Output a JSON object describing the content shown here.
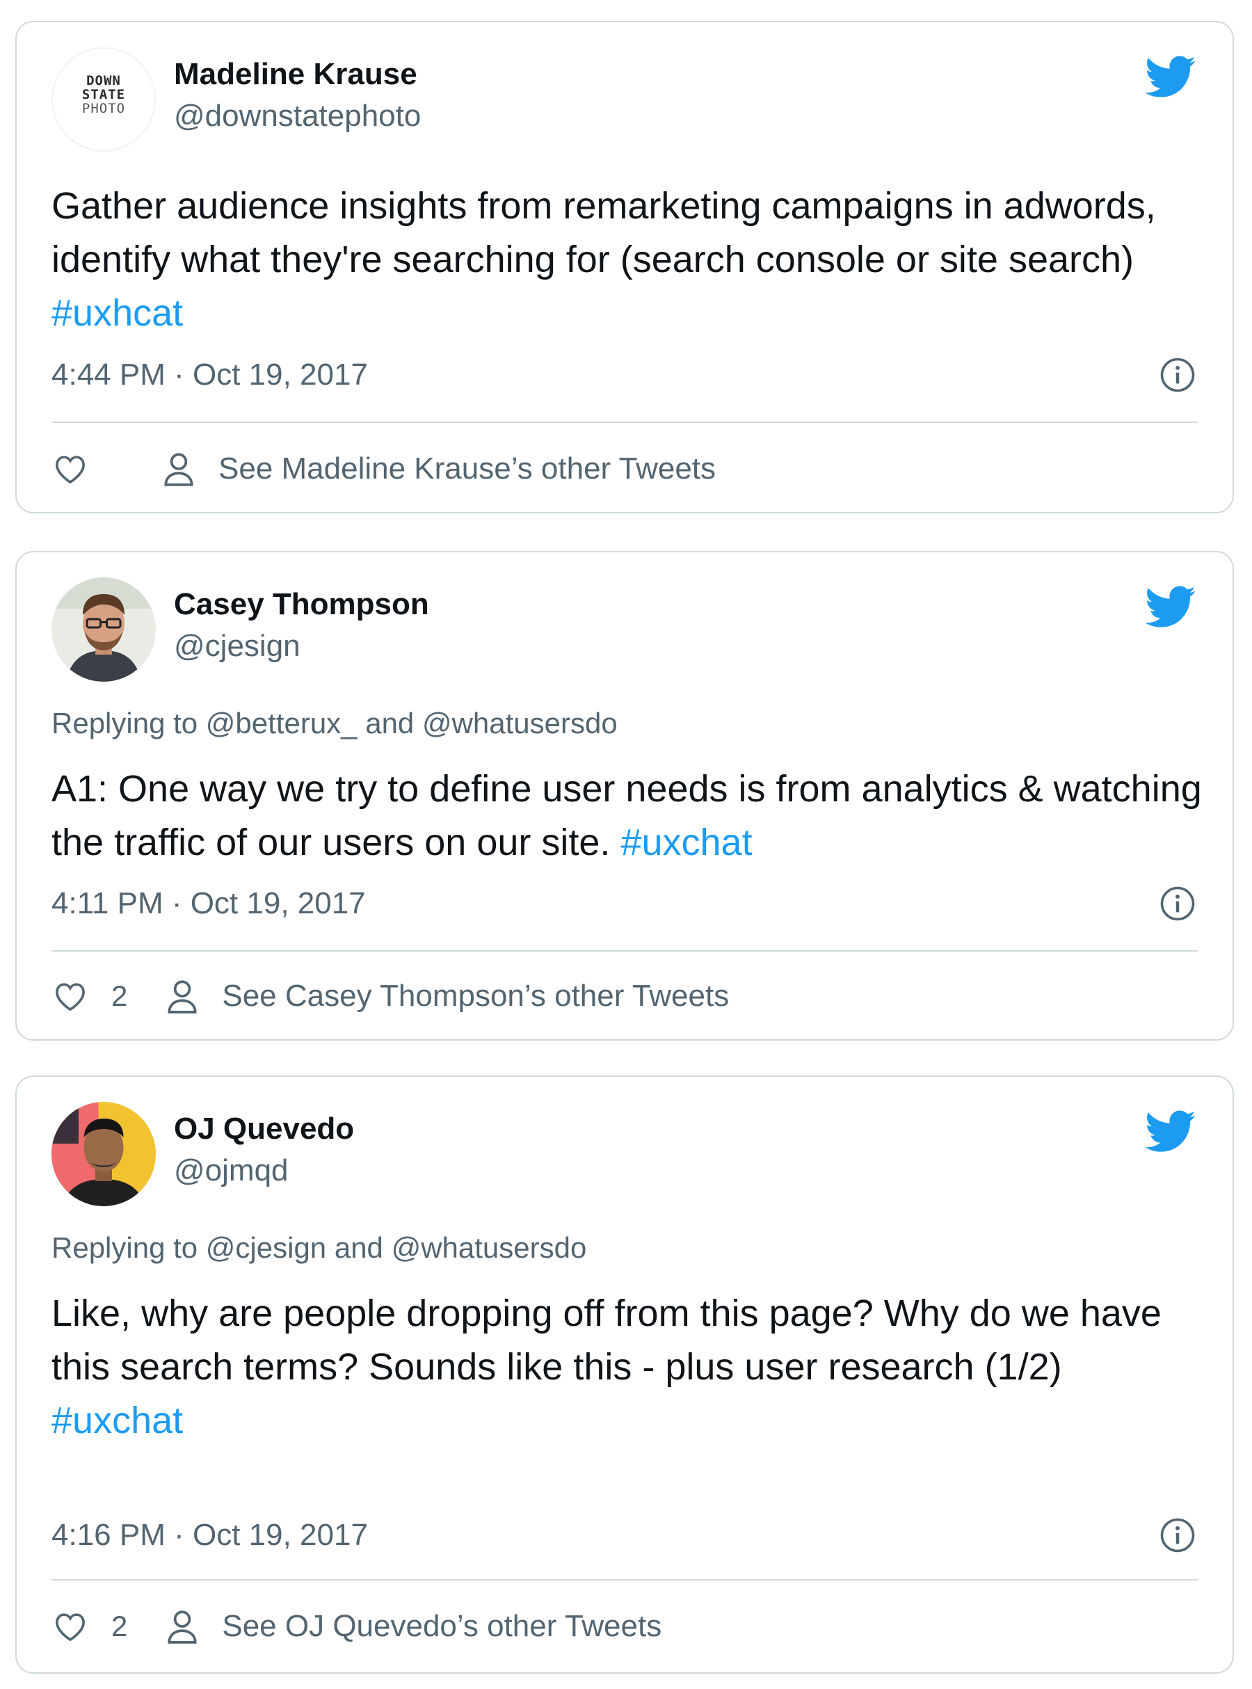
{
  "tweets": [
    {
      "name": "Madeline Krause",
      "handle": "@downstatephoto",
      "avatar_logo": [
        "DOWN",
        "STATE",
        "PHOTO"
      ],
      "replying_to": "",
      "text": "Gather audience insights from remarketing campaigns in adwords, identify what they're searching for (search console or site search)",
      "hashtag": "#uxhcat",
      "timestamp": "4:44 PM · Oct 19, 2017",
      "likes": "",
      "other_tweets": "See Madeline Krause’s other Tweets"
    },
    {
      "name": "Casey Thompson",
      "handle": "@cjesign",
      "replying_to": "Replying to @betterux_ and @whatusersdo",
      "text": "A1: One way we try to define user needs is from analytics & watching the traffic of our users on our site.",
      "hashtag": "#uxchat",
      "timestamp": "4:11 PM · Oct 19, 2017",
      "likes": "2",
      "other_tweets": "See Casey Thompson’s other Tweets"
    },
    {
      "name": "OJ Quevedo",
      "handle": "@ojmqd",
      "replying_to": "Replying to @cjesign and @whatusersdo",
      "text": "Like, why are people dropping off from this page? Why do we have this search terms? Sounds like this - plus user research (1/2)",
      "hashtag": "#uxchat",
      "timestamp": "4:16 PM · Oct 19, 2017",
      "likes": "2",
      "other_tweets": "See OJ Quevedo’s other Tweets"
    }
  ],
  "icons": {
    "brand": "twitter-bird-icon",
    "info": "info-icon",
    "like": "heart-icon",
    "profile": "person-icon"
  },
  "colors": {
    "brand": "#1d9bf0",
    "secondary_text": "#536471",
    "border": "#cfd9de",
    "primary_text": "#0f1419"
  }
}
